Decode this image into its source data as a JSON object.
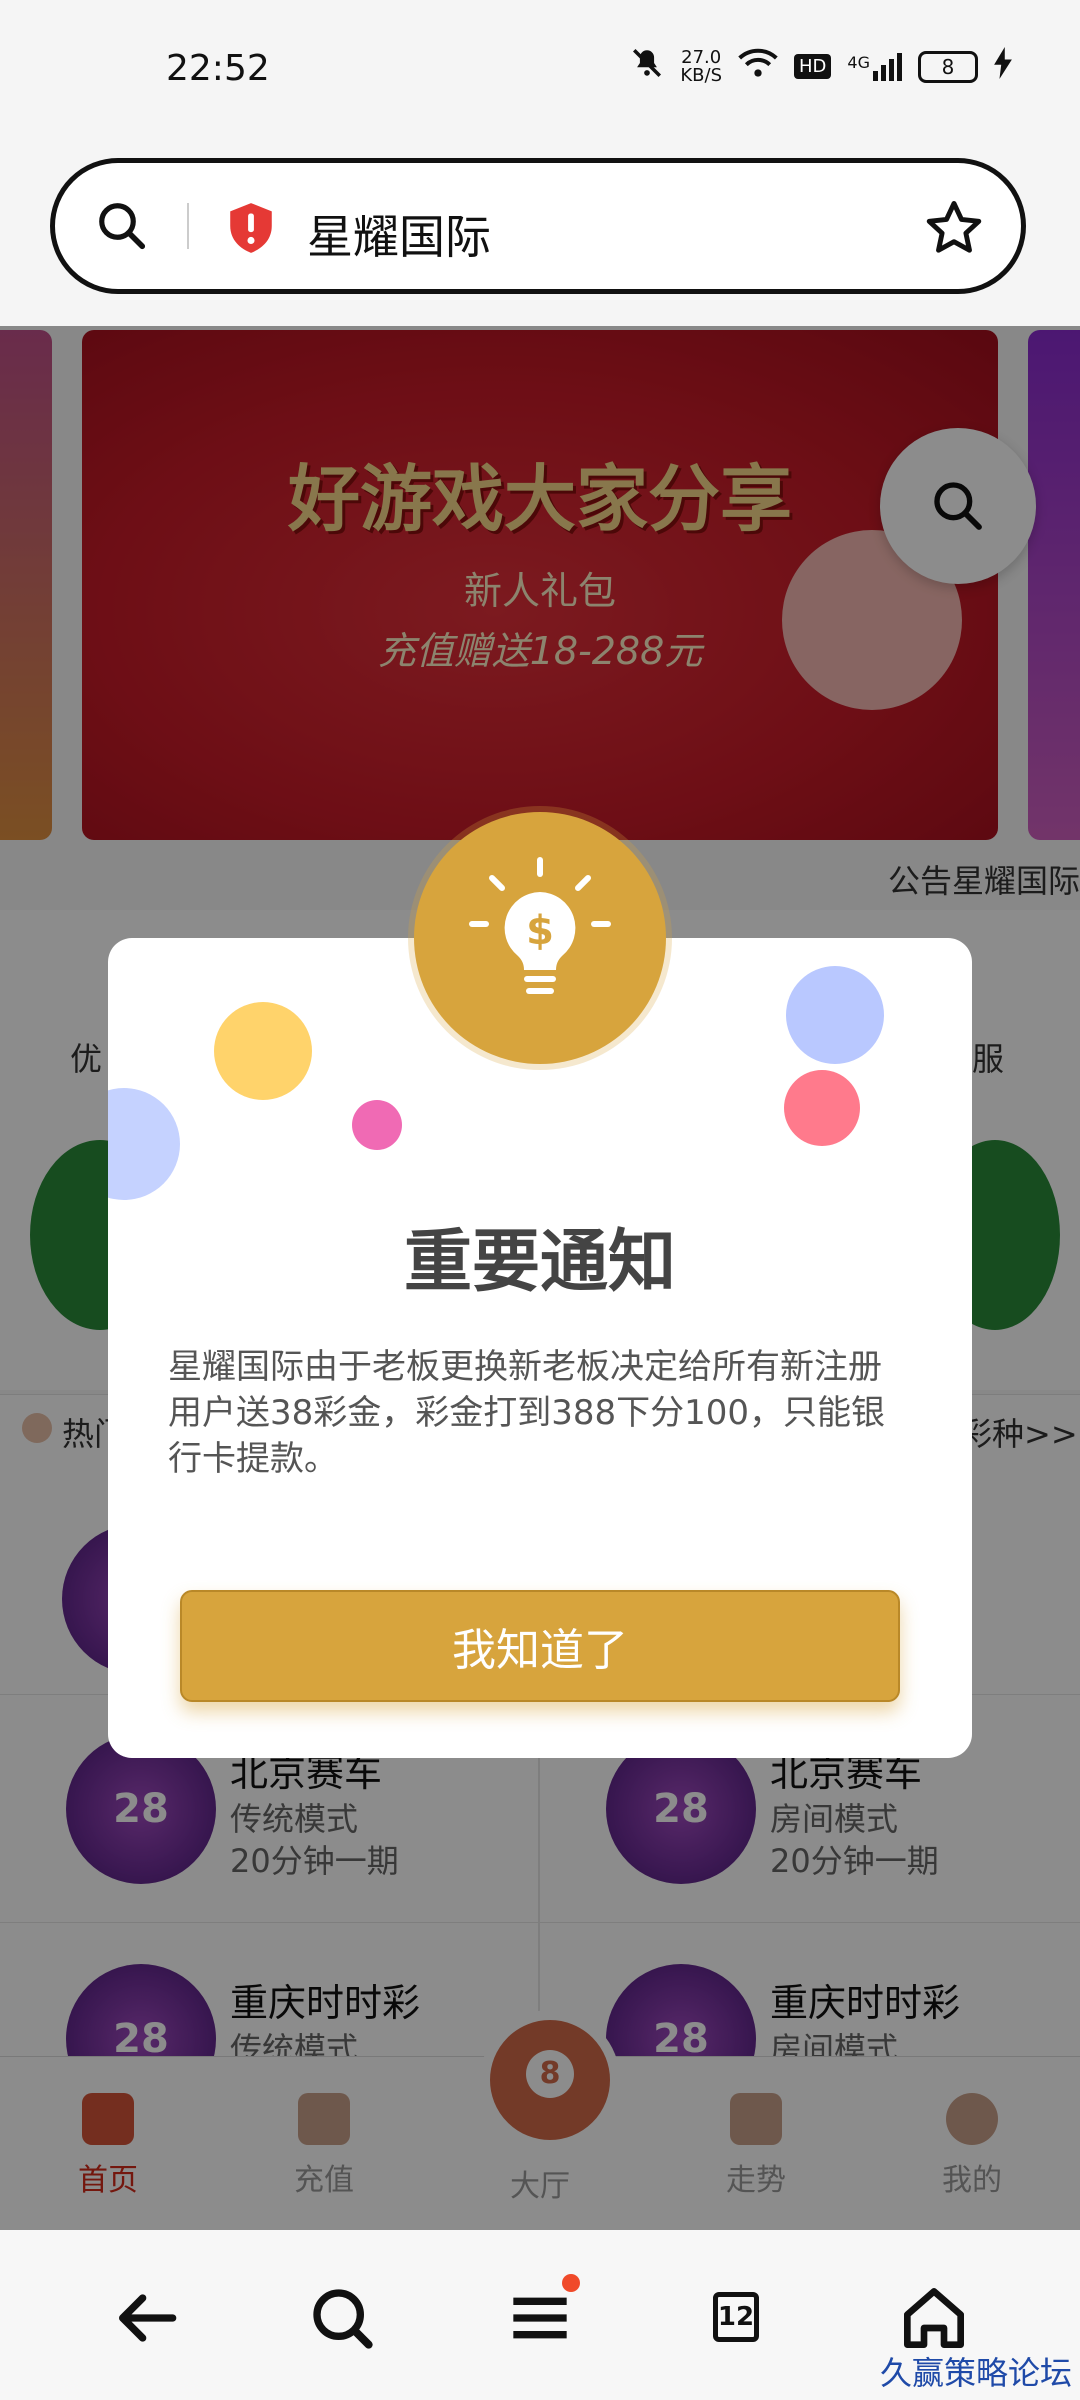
{
  "status_bar": {
    "time": "22:52",
    "net_speed_value": "27.0",
    "net_speed_unit": "KB/S",
    "hd": "HD",
    "network": "4G",
    "battery": "8"
  },
  "address_bar": {
    "site_name": "星耀国际",
    "icons": [
      "search-icon",
      "shield-alert-icon",
      "star-icon"
    ]
  },
  "banner": {
    "title": "好游戏大家分享",
    "subtitle": "新人礼包",
    "promo": "充值赠送18-288元"
  },
  "notice_marquee": "公告星耀国际",
  "partial_labels": {
    "left_top": "优",
    "right_top": "客服",
    "left_mid": "热门",
    "right_mid": "彩种>>"
  },
  "games": [
    {
      "title": "北京赛车",
      "mode": "传统模式",
      "period": "20分钟一期",
      "icon_text": "28"
    },
    {
      "title": "北京赛车",
      "mode": "房间模式",
      "period": "20分钟一期",
      "icon_text": "28"
    },
    {
      "title": "重庆时时彩",
      "mode": "传统模式",
      "icon_text": "28"
    },
    {
      "title": "重庆时时彩",
      "mode": "房间模式",
      "icon_text": "28"
    }
  ],
  "tabbar": [
    {
      "label": "首页",
      "active": true
    },
    {
      "label": "充值",
      "active": false
    },
    {
      "label": "大厅",
      "active": false
    },
    {
      "label": "走势",
      "active": false
    },
    {
      "label": "我的",
      "active": false
    }
  ],
  "modal": {
    "title": "重要通知",
    "body": "星耀国际由于老板更换新老板决定给所有新注册用户送38彩金，彩金打到388下分100，只能银行卡提款。",
    "button": "我知道了",
    "icon": "dollar-bulb-icon",
    "accent_color": "#d7a43d"
  },
  "system_nav": {
    "tab_count": "12",
    "icons": [
      "back-arrow-icon",
      "search-icon",
      "menu-icon",
      "tabs-icon",
      "home-icon"
    ]
  },
  "watermark": "久赢策略论坛"
}
